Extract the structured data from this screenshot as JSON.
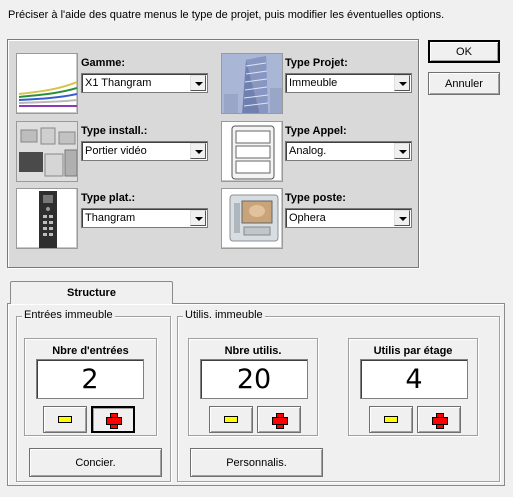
{
  "instruction": "Préciser à l'aide des quatre menus le type de projet, puis modifier les éventuelles options.",
  "dialog": {
    "ok_label": "OK",
    "cancel_label": "Annuler"
  },
  "fields": {
    "gamme": {
      "label": "Gamme:",
      "value": "X1 Thangram"
    },
    "type_projet": {
      "label": "Type Projet:",
      "value": "Immeuble"
    },
    "type_install": {
      "label": "Type install.:",
      "value": "Portier vidéo"
    },
    "type_appel": {
      "label": "Type Appel:",
      "value": "Analog."
    },
    "type_plat": {
      "label": "Type plat.:",
      "value": "Thangram"
    },
    "type_poste": {
      "label": "Type poste:",
      "value": "Ophera"
    }
  },
  "tabs": [
    {
      "label": "Structure"
    }
  ],
  "groups": {
    "entrees": {
      "legend": "Entrées immeuble",
      "counter_title": "Nbre d'entrées",
      "value": "2",
      "button_label": "Concier."
    },
    "utilis": {
      "legend": "Utilis. immeuble",
      "counter1_title": "Nbre utilis.",
      "counter1_value": "20",
      "counter2_title": "Utilis par étage",
      "counter2_value": "4",
      "button_label": "Personnalis."
    }
  },
  "icons": {
    "decrement": "minus-icon",
    "increment": "plus-icon",
    "dropdown": "chevron-down-icon"
  }
}
